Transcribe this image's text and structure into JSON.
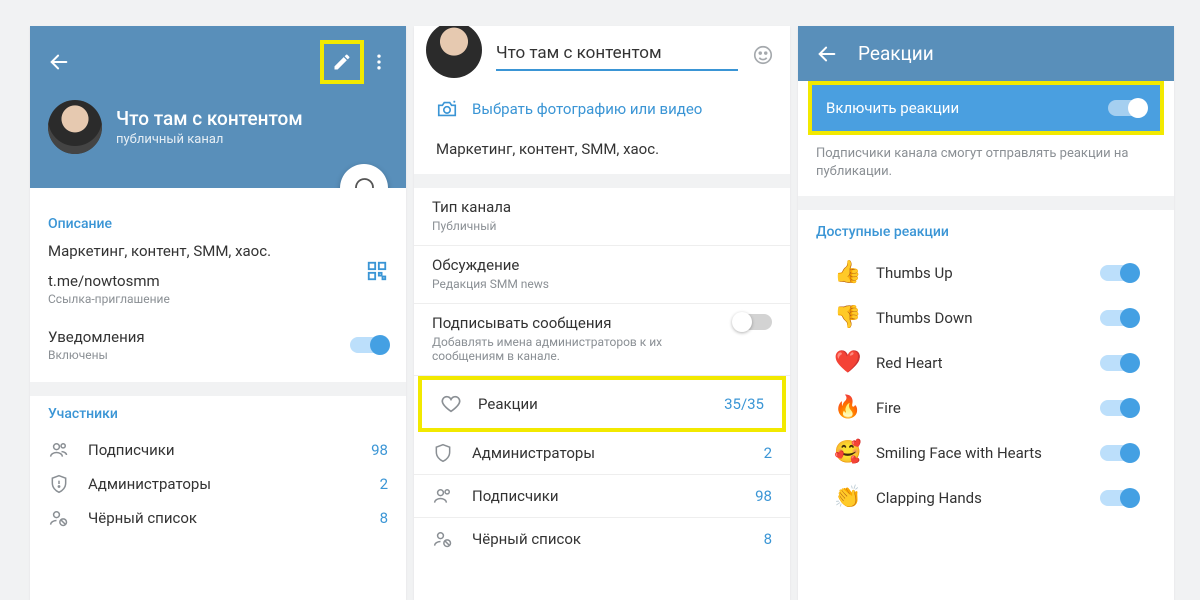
{
  "panel1": {
    "title": "Что там с контентом",
    "subtitle": "публичный канал",
    "section_desc_title": "Описание",
    "desc": "Маркетинг, контент, SMM, хаос.",
    "link": "t.me/nowtosmm",
    "link_sub": "Ссылка-приглашение",
    "notif_label": "Уведомления",
    "notif_value": "Включены",
    "members_title": "Участники",
    "rows": [
      {
        "label": "Подписчики",
        "value": "98"
      },
      {
        "label": "Администраторы",
        "value": "2"
      },
      {
        "label": "Чёрный список",
        "value": "8"
      }
    ]
  },
  "panel2": {
    "name_input": "Что там с контентом",
    "choose_media": "Выбрать фотографию или видео",
    "desc": "Маркетинг, контент, SMM, хаос.",
    "type_label": "Тип канала",
    "type_value": "Публичный",
    "discuss_label": "Обсуждение",
    "discuss_value": "Редакция SMM news",
    "sign_label": "Подписывать сообщения",
    "sign_sub": "Добавлять имена администраторов к их сообщениям в канале.",
    "react_label": "Реакции",
    "react_value": "35/35",
    "rows": [
      {
        "label": "Администраторы",
        "value": "2"
      },
      {
        "label": "Подписчики",
        "value": "98"
      },
      {
        "label": "Чёрный список",
        "value": "8"
      }
    ]
  },
  "panel3": {
    "title": "Реакции",
    "enable_label": "Включить реакции",
    "hint": "Подписчики канала смогут отправлять реакции на публикации.",
    "avail_title": "Доступные реакции",
    "reactions": [
      {
        "emoji": "👍",
        "label": "Thumbs Up"
      },
      {
        "emoji": "👎",
        "label": "Thumbs Down"
      },
      {
        "emoji": "❤️",
        "label": "Red Heart"
      },
      {
        "emoji": "🔥",
        "label": "Fire"
      },
      {
        "emoji": "🥰",
        "label": "Smiling Face with Hearts"
      },
      {
        "emoji": "👏",
        "label": "Clapping Hands"
      }
    ]
  }
}
